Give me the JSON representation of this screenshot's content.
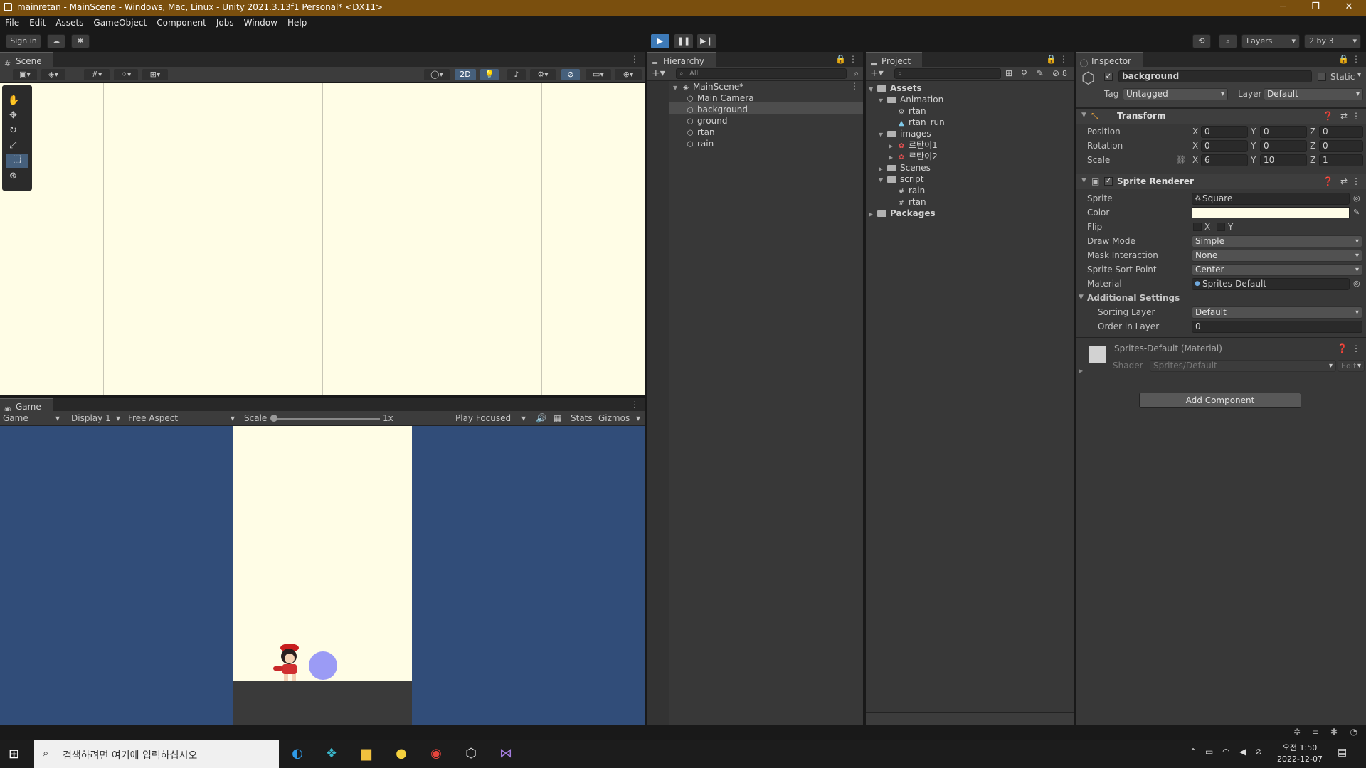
{
  "window": {
    "title": "mainretan - MainScene - Windows, Mac, Linux - Unity 2021.3.13f1 Personal* <DX11>",
    "minimize": "─",
    "maximize": "❐",
    "close": "✕"
  },
  "menu": [
    "File",
    "Edit",
    "Assets",
    "GameObject",
    "Component",
    "Jobs",
    "Window",
    "Help"
  ],
  "toolbar": {
    "sign_in": "Sign in",
    "layers": "Layers",
    "layout": "2 by 3"
  },
  "scene": {
    "tab": "Scene",
    "mode_2d": "2D"
  },
  "game": {
    "tab": "Game",
    "view": "Game",
    "display": "Display 1",
    "aspect": "Free Aspect",
    "scale_label": "Scale",
    "scale_value": "1x",
    "play_mode": "Play Focused",
    "stats": "Stats",
    "gizmos": "Gizmos"
  },
  "hierarchy": {
    "tab": "Hierarchy",
    "search_placeholder": "All",
    "scene": "MainScene*",
    "items": [
      "Main Camera",
      "background",
      "ground",
      "rtan",
      "rain"
    ]
  },
  "project": {
    "tab": "Project",
    "badge": "8",
    "tree": {
      "assets": "Assets",
      "animation": "Animation",
      "rtan_anim": "rtan",
      "rtan_run": "rtan_run",
      "images": "images",
      "img1": "르탄이1",
      "img2": "르탄이2",
      "scenes": "Scenes",
      "script": "script",
      "script_rain": "rain",
      "script_rtan": "rtan",
      "packages": "Packages"
    }
  },
  "inspector": {
    "tab": "Inspector",
    "object_name": "background",
    "static": "Static",
    "tag_label": "Tag",
    "tag_value": "Untagged",
    "layer_label": "Layer",
    "layer_value": "Default",
    "transform": {
      "title": "Transform",
      "position": {
        "label": "Position",
        "x": "0",
        "y": "0",
        "z": "0"
      },
      "rotation": {
        "label": "Rotation",
        "x": "0",
        "y": "0",
        "z": "0"
      },
      "scale": {
        "label": "Scale",
        "x": "6",
        "y": "10",
        "z": "1"
      }
    },
    "sprite_renderer": {
      "title": "Sprite Renderer",
      "sprite_label": "Sprite",
      "sprite_value": "Square",
      "color_label": "Color",
      "color_value": "#fffde8",
      "flip_label": "Flip",
      "flip_x": "X",
      "flip_y": "Y",
      "draw_mode_label": "Draw Mode",
      "draw_mode_value": "Simple",
      "mask_label": "Mask Interaction",
      "mask_value": "None",
      "sort_point_label": "Sprite Sort Point",
      "sort_point_value": "Center",
      "material_label": "Material",
      "material_value": "Sprites-Default",
      "additional": "Additional Settings",
      "sorting_layer_label": "Sorting Layer",
      "sorting_layer_value": "Default",
      "order_label": "Order in Layer",
      "order_value": "0"
    },
    "material": {
      "title": "Sprites-Default (Material)",
      "shader_label": "Shader",
      "shader_value": "Sprites/Default",
      "edit": "Edit..."
    },
    "add_component": "Add Component",
    "axis": {
      "x": "X",
      "y": "Y",
      "z": "Z"
    }
  },
  "colors": {
    "scene_bg": "#fffde6",
    "game_bg": "#314d79",
    "ground": "#3a3a3a",
    "rain_drop": "#9b9bf5"
  },
  "taskbar": {
    "search_placeholder": "검색하려면 여기에 입력하십시오",
    "time": "오전 1:50",
    "date": "2022-12-07"
  }
}
